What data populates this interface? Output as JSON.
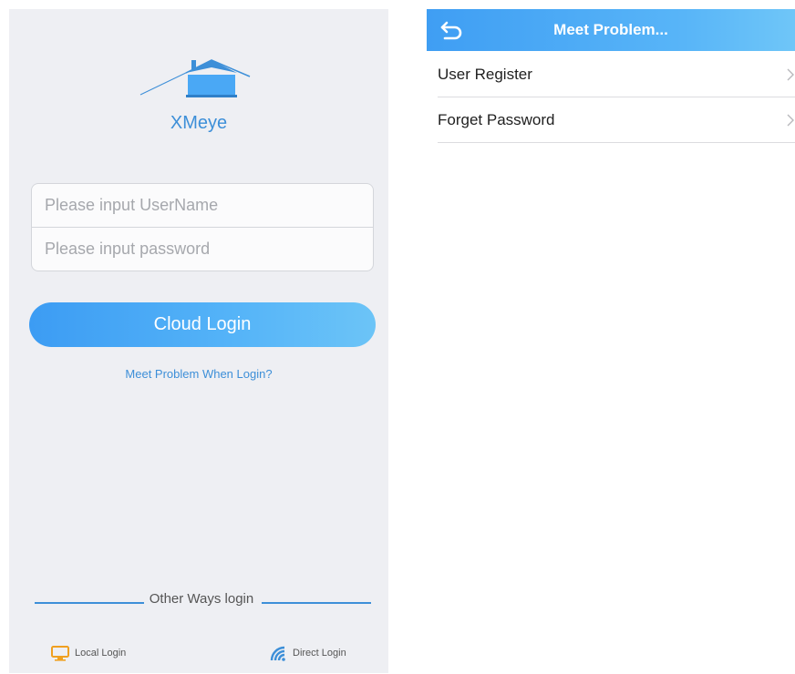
{
  "login": {
    "app_name": "XMeye",
    "username_placeholder": "Please input UserName",
    "password_placeholder": "Please input password",
    "cloud_login_label": "Cloud Login",
    "meet_problem_link": "Meet Problem When Login?",
    "other_ways_label": "Other Ways login",
    "local_login_label": "Local Login",
    "direct_login_label": "Direct Login"
  },
  "problem": {
    "title": "Meet Problem...",
    "items": [
      {
        "label": "User Register"
      },
      {
        "label": "Forget Password"
      }
    ]
  },
  "icons": {
    "logo": "house-logo-icon",
    "local_login": "monitor-icon",
    "direct_login": "wifi-icon",
    "back": "back-arrow-icon",
    "chevron": "chevron-right-icon"
  },
  "colors": {
    "accent": "#3d8fd8",
    "button": "#4aa8f5",
    "header": "#4fadf6",
    "local_icon": "#f0a020",
    "background": "#eeeff3"
  }
}
